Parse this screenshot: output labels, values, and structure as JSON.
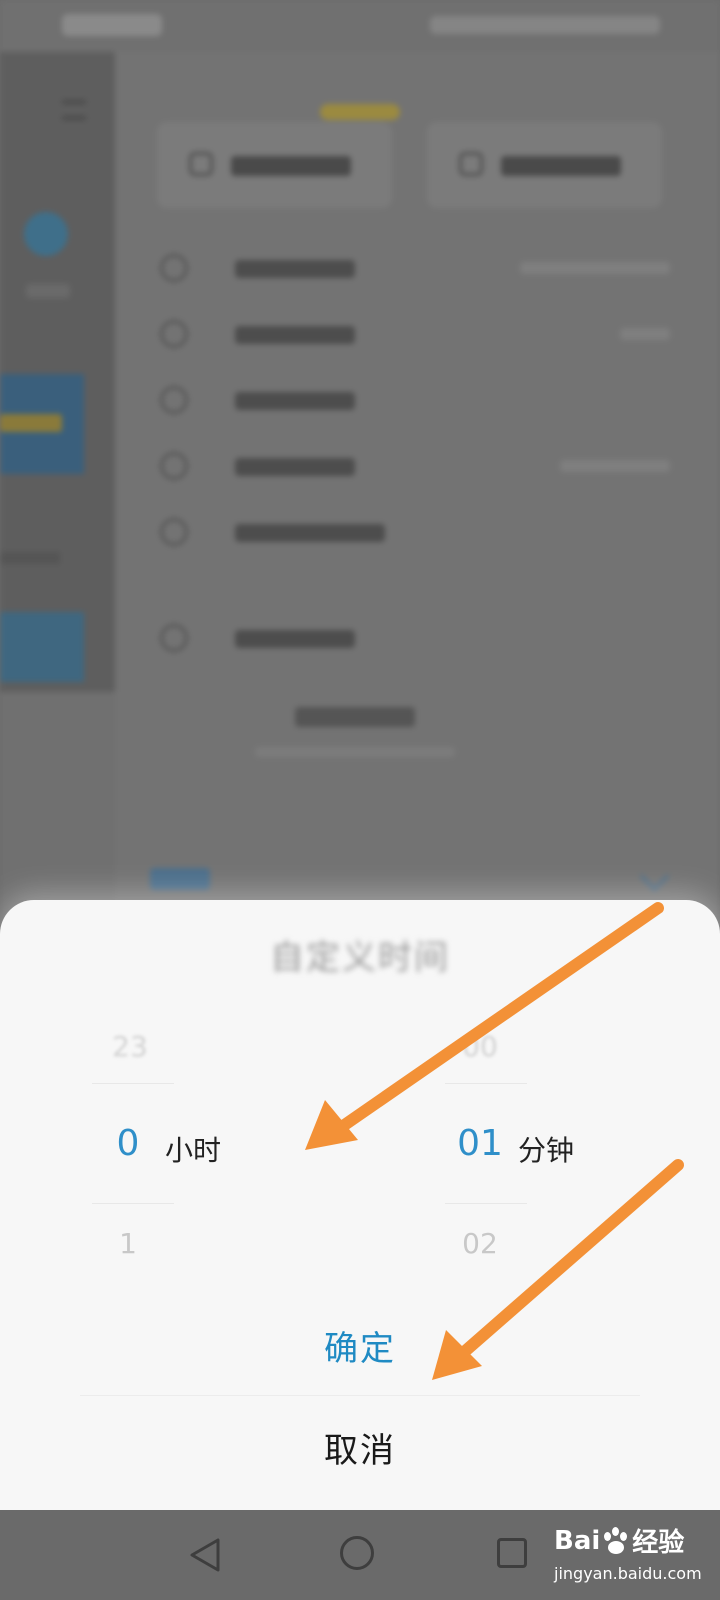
{
  "dialog": {
    "title": "自定义时间",
    "hour_column": {
      "prev": "23",
      "selected": "0",
      "next": "1",
      "unit": "小时"
    },
    "minute_column": {
      "prev": "00",
      "selected": "01",
      "next": "02",
      "unit": "分钟"
    },
    "confirm_label": "确定",
    "cancel_label": "取消"
  },
  "navbar": {
    "icons": [
      "back-icon",
      "home-icon",
      "recent-apps-icon"
    ]
  },
  "watermark": {
    "logo_left": "Bai",
    "logo_right": "经验",
    "site": "jingyan.baidu.com"
  },
  "colors": {
    "accent": "#1f8ac3",
    "annotation_arrow": "#f39137",
    "overlay": "#6b6b6b"
  }
}
